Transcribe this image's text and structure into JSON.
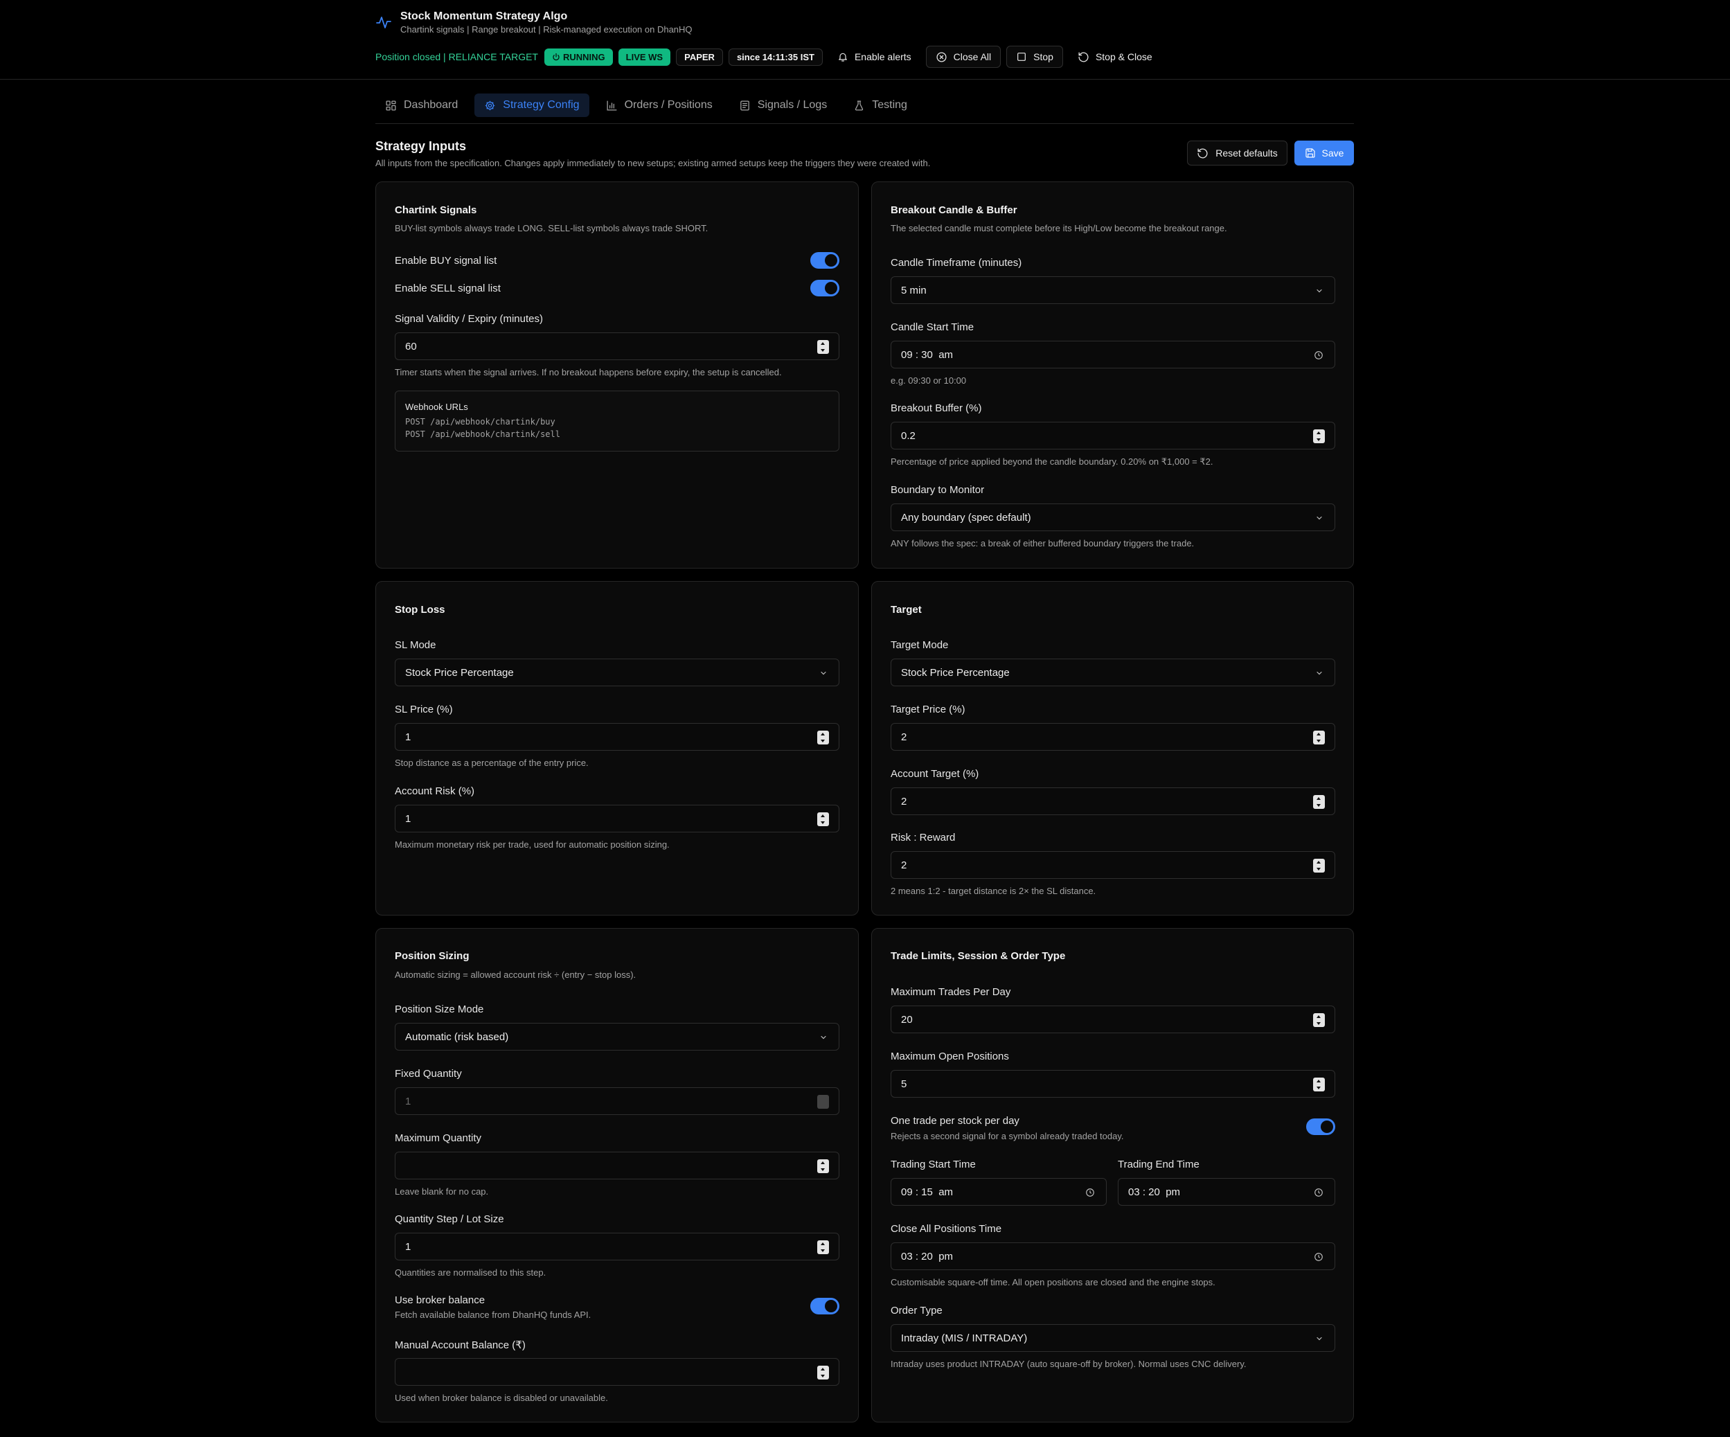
{
  "header": {
    "title": "Stock Momentum Strategy Algo",
    "subtitle": "Chartink signals | Range breakout | Risk-managed execution on DhanHQ",
    "position_status": "Position closed | RELIANCE TARGET",
    "badges": {
      "running": "RUNNING",
      "live_ws": "LIVE WS",
      "paper": "PAPER",
      "since": "since 14:11:35 IST"
    },
    "buttons": {
      "enable_alerts": "Enable alerts",
      "close_all": "Close All",
      "stop": "Stop",
      "stop_close": "Stop & Close"
    }
  },
  "tabs": [
    {
      "label": "Dashboard",
      "icon": "grid-icon"
    },
    {
      "label": "Strategy Config",
      "icon": "gear-icon",
      "active": true
    },
    {
      "label": "Orders / Positions",
      "icon": "bar-chart-icon"
    },
    {
      "label": "Signals / Logs",
      "icon": "log-icon"
    },
    {
      "label": "Testing",
      "icon": "flask-icon"
    }
  ],
  "section": {
    "title": "Strategy Inputs",
    "description": "All inputs from the specification. Changes apply immediately to new setups; existing armed setups keep the triggers they were created with.",
    "reset_label": "Reset defaults",
    "save_label": "Save"
  },
  "chartink": {
    "title": "Chartink Signals",
    "description": "BUY-list symbols always trade LONG. SELL-list symbols always trade SHORT.",
    "enable_buy_label": "Enable BUY signal list",
    "enable_buy": true,
    "enable_sell_label": "Enable SELL signal list",
    "enable_sell": true,
    "validity_label": "Signal Validity / Expiry (minutes)",
    "validity_value": "60",
    "validity_help": "Timer starts when the signal arrives. If no breakout happens before expiry, the setup is cancelled.",
    "webhook_title": "Webhook URLs",
    "webhook_buy": "POST /api/webhook/chartink/buy",
    "webhook_sell": "POST /api/webhook/chartink/sell"
  },
  "breakout": {
    "title": "Breakout Candle & Buffer",
    "description": "The selected candle must complete before its High/Low become the breakout range.",
    "timeframe_label": "Candle Timeframe (minutes)",
    "timeframe_value": "5 min",
    "start_label": "Candle Start Time",
    "start_value": "09 : 30  am",
    "start_help": "e.g. 09:30 or 10:00",
    "buffer_label": "Breakout Buffer (%)",
    "buffer_value": "0.2",
    "buffer_help": "Percentage of price applied beyond the candle boundary. 0.20% on ₹1,000 = ₹2.",
    "boundary_label": "Boundary to Monitor",
    "boundary_value": "Any boundary (spec default)",
    "boundary_help": "ANY follows the spec: a break of either buffered boundary triggers the trade."
  },
  "stoploss": {
    "title": "Stop Loss",
    "mode_label": "SL Mode",
    "mode_value": "Stock Price Percentage",
    "price_label": "SL Price (%)",
    "price_value": "1",
    "price_help": "Stop distance as a percentage of the entry price.",
    "risk_label": "Account Risk (%)",
    "risk_value": "1",
    "risk_help": "Maximum monetary risk per trade, used for automatic position sizing."
  },
  "target": {
    "title": "Target",
    "mode_label": "Target Mode",
    "mode_value": "Stock Price Percentage",
    "price_label": "Target Price (%)",
    "price_value": "2",
    "account_label": "Account Target (%)",
    "account_value": "2",
    "rr_label": "Risk : Reward",
    "rr_value": "2",
    "rr_help": "2 means 1:2 - target distance is 2× the SL distance."
  },
  "sizing": {
    "title": "Position Sizing",
    "description": "Automatic sizing = allowed account risk ÷ (entry − stop loss).",
    "mode_label": "Position Size Mode",
    "mode_value": "Automatic (risk based)",
    "fixed_label": "Fixed Quantity",
    "fixed_value": "1",
    "max_label": "Maximum Quantity",
    "max_value": "",
    "max_help": "Leave blank for no cap.",
    "step_label": "Quantity Step / Lot Size",
    "step_value": "1",
    "step_help": "Quantities are normalised to this step.",
    "broker_label": "Use broker balance",
    "broker_help": "Fetch available balance from DhanHQ funds API.",
    "broker_enabled": true,
    "manual_label": "Manual Account Balance (₹)",
    "manual_value": "",
    "manual_help": "Used when broker balance is disabled or unavailable."
  },
  "limits": {
    "title": "Trade Limits, Session & Order Type",
    "max_trades_label": "Maximum Trades Per Day",
    "max_trades_value": "20",
    "max_open_label": "Maximum Open Positions",
    "max_open_value": "5",
    "one_trade_label": "One trade per stock per day",
    "one_trade_help": "Rejects a second signal for a symbol already traded today.",
    "one_trade_enabled": true,
    "start_label": "Trading Start Time",
    "start_value": "09 : 15  am",
    "end_label": "Trading End Time",
    "end_value": "03 : 20  pm",
    "close_label": "Close All Positions Time",
    "close_value": "03 : 20  pm",
    "close_help": "Customisable square-off time. All open positions are closed and the engine stops.",
    "order_label": "Order Type",
    "order_value": "Intraday (MIS / INTRADAY)",
    "order_help": "Intraday uses product INTRADAY (auto square-off by broker). Normal uses CNC delivery."
  },
  "colors": {
    "accent": "#3b82f6",
    "success": "#10b981",
    "background": "#000000",
    "card": "#0b0b0b",
    "border": "#262626"
  }
}
